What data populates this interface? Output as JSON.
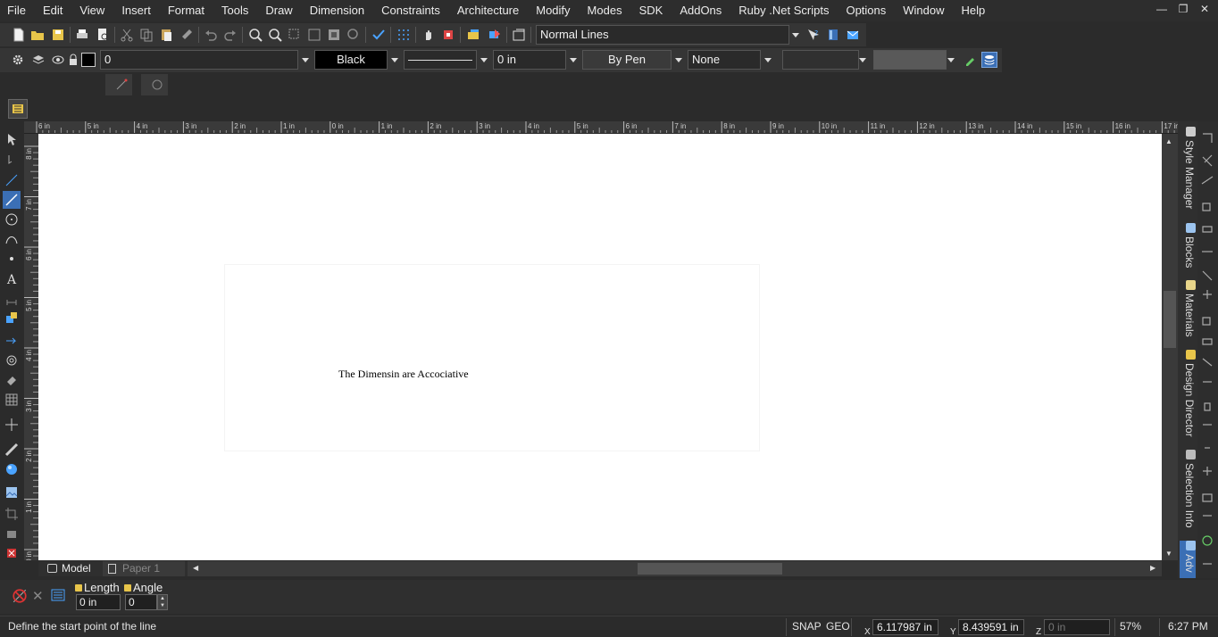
{
  "menubar": {
    "items": [
      "File",
      "Edit",
      "View",
      "Insert",
      "Format",
      "Tools",
      "Draw",
      "Dimension",
      "Constraints",
      "Architecture",
      "Modify",
      "Modes",
      "SDK",
      "AddOns",
      "Ruby .Net Scripts",
      "Options",
      "Window",
      "Help"
    ]
  },
  "toolbar1": {
    "line_style_value": "Normal Lines"
  },
  "toolbar2": {
    "layer_value": "0",
    "color_value": "Black",
    "thickness_value": "0 in",
    "pen_value": "By Pen",
    "fill_value": "None"
  },
  "ruler": {
    "top_labels": [
      "6 in",
      "5 in",
      "4 in",
      "3 in",
      "2 in",
      "1 in",
      "0 in",
      "1 in",
      "2 in",
      "3 in",
      "4 in",
      "5 in",
      "6 in",
      "7 in",
      "8 in",
      "9 in",
      "10 in",
      "11 in",
      "12 in",
      "13 in",
      "14 in",
      "15 in",
      "16 in",
      "17 in"
    ],
    "left_labels": [
      "8 in",
      "7 in",
      "6 in",
      "5 in",
      "4 in",
      "3 in",
      "2 in",
      "1 in",
      "0 in"
    ]
  },
  "canvas": {
    "text": "The Dimensin are Accociative"
  },
  "right_panel": {
    "tabs": [
      "Style Manager",
      "Blocks",
      "Materials",
      "Design Director",
      "Selection Info",
      "Adv"
    ]
  },
  "bottom_tabs": {
    "model": "Model",
    "paper": "Paper 1"
  },
  "input_bar": {
    "length_label": "Length",
    "angle_label": "Angle",
    "length_value": "0 in",
    "angle_value": "0"
  },
  "status_bar": {
    "prompt": "Define the start point of the line",
    "snap": "SNAP",
    "geo": "GEO",
    "x_label": "X",
    "x_value": "6.117987 in",
    "y_label": "Y",
    "y_value": "8.439591 in",
    "z_label": "Z",
    "z_placeholder": "0 in",
    "zoom": "57%",
    "time": "6:27 PM"
  },
  "colors": {
    "background": "#2b2b2b",
    "canvas": "#ffffff",
    "accent": "#3b8fd6"
  }
}
